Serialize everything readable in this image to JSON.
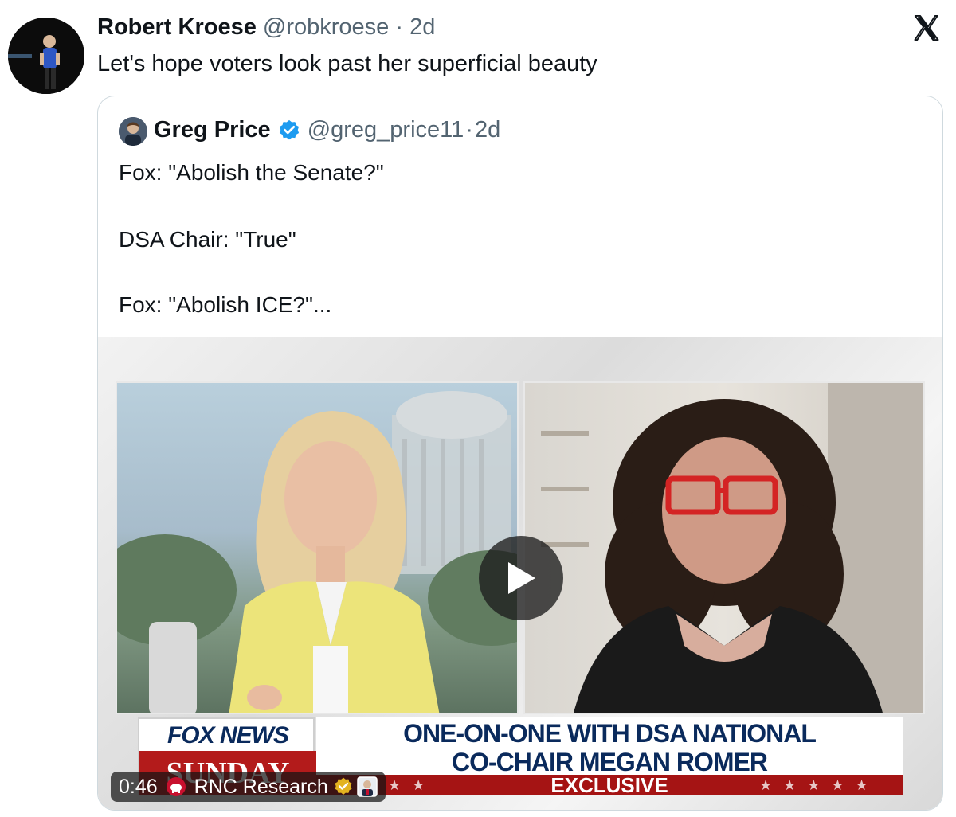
{
  "tweet": {
    "author_name": "Robert Kroese",
    "author_handle": "@robkroese",
    "separator": "·",
    "time": "2d",
    "text": "Let's hope voters look past her superficial beauty"
  },
  "quoted": {
    "author_name": "Greg Price",
    "author_handle": "@greg_price11",
    "separator": "·",
    "time": "2d",
    "lines": [
      "Fox: \"Abolish the Senate?\"",
      "DSA Chair: \"True\"",
      "Fox: \"Abolish ICE?\"..."
    ]
  },
  "video": {
    "logo_top": "FOX NEWS",
    "logo_bottom": "SUNDAY",
    "headline_line1": "ONE-ON-ONE WITH DSA NATIONAL",
    "headline_line2": "CO-CHAIR MEGAN ROMER",
    "banner": "EXCLUSIVE",
    "duration": "0:46",
    "source": "RNC Research"
  },
  "colors": {
    "verified_blue": "#1d9bf0",
    "fox_red": "#b31b1b",
    "fox_navy": "#0a2a5c",
    "meta_gray": "#536471"
  },
  "icons": [
    "x-logo-icon",
    "verified-badge-icon",
    "play-icon",
    "rnc-logo-icon",
    "gold-check-icon"
  ]
}
